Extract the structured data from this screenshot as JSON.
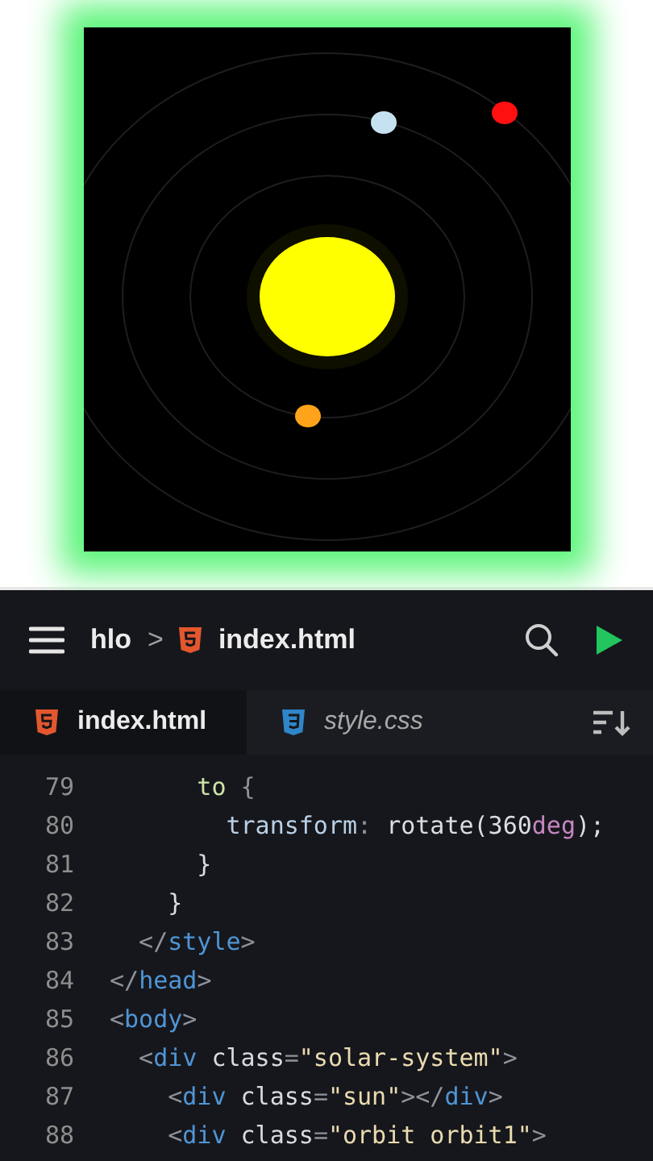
{
  "preview": {
    "planets": [
      {
        "color": "#ffa31a"
      },
      {
        "color": "#c6e2f0"
      },
      {
        "color": "#ff1010"
      }
    ]
  },
  "header": {
    "project": "hlo",
    "separator": ">",
    "file": "index.html"
  },
  "tabs": [
    {
      "label": "index.html",
      "kind": "html",
      "selected": true
    },
    {
      "label": "style.css",
      "kind": "css",
      "selected": false
    }
  ],
  "code_lines": [
    {
      "number": "79",
      "tokens": [
        {
          "kind": "keyword",
          "text": "      to"
        },
        {
          "kind": "punct",
          "text": " {"
        }
      ]
    },
    {
      "number": "80",
      "tokens": [
        {
          "kind": "prop",
          "text": "        transform"
        },
        {
          "kind": "punct",
          "text": ": "
        },
        {
          "kind": "value",
          "text": "rotate(360"
        },
        {
          "kind": "unit",
          "text": "deg"
        },
        {
          "kind": "value",
          "text": ");"
        }
      ]
    },
    {
      "number": "81",
      "tokens": [
        {
          "kind": "value",
          "text": "      }"
        }
      ]
    },
    {
      "number": "82",
      "tokens": [
        {
          "kind": "value",
          "text": "    }"
        }
      ]
    },
    {
      "number": "83",
      "tokens": [
        {
          "kind": "punct",
          "text": "  </"
        },
        {
          "kind": "tag",
          "text": "style"
        },
        {
          "kind": "punct",
          "text": ">"
        }
      ]
    },
    {
      "number": "84",
      "tokens": [
        {
          "kind": "punct",
          "text": "</"
        },
        {
          "kind": "tag",
          "text": "head"
        },
        {
          "kind": "punct",
          "text": ">"
        }
      ]
    },
    {
      "number": "85",
      "tokens": [
        {
          "kind": "punct",
          "text": "<"
        },
        {
          "kind": "tag",
          "text": "body"
        },
        {
          "kind": "punct",
          "text": ">"
        }
      ]
    },
    {
      "number": "86",
      "tokens": [
        {
          "kind": "punct",
          "text": "  <"
        },
        {
          "kind": "tag",
          "text": "div"
        },
        {
          "kind": "attr",
          "text": " class"
        },
        {
          "kind": "punct",
          "text": "="
        },
        {
          "kind": "string",
          "text": "\"solar-system\""
        },
        {
          "kind": "punct",
          "text": ">"
        }
      ]
    },
    {
      "number": "87",
      "tokens": [
        {
          "kind": "punct",
          "text": "    <"
        },
        {
          "kind": "tag",
          "text": "div"
        },
        {
          "kind": "attr",
          "text": " class"
        },
        {
          "kind": "punct",
          "text": "="
        },
        {
          "kind": "string",
          "text": "\"sun\""
        },
        {
          "kind": "punct",
          "text": "></"
        },
        {
          "kind": "tag",
          "text": "div"
        },
        {
          "kind": "punct",
          "text": ">"
        }
      ]
    },
    {
      "number": "88",
      "tokens": [
        {
          "kind": "punct",
          "text": "    <"
        },
        {
          "kind": "tag",
          "text": "div"
        },
        {
          "kind": "attr",
          "text": " class"
        },
        {
          "kind": "punct",
          "text": "="
        },
        {
          "kind": "string",
          "text": "\"orbit orbit1\""
        },
        {
          "kind": "punct",
          "text": ">"
        }
      ]
    }
  ]
}
